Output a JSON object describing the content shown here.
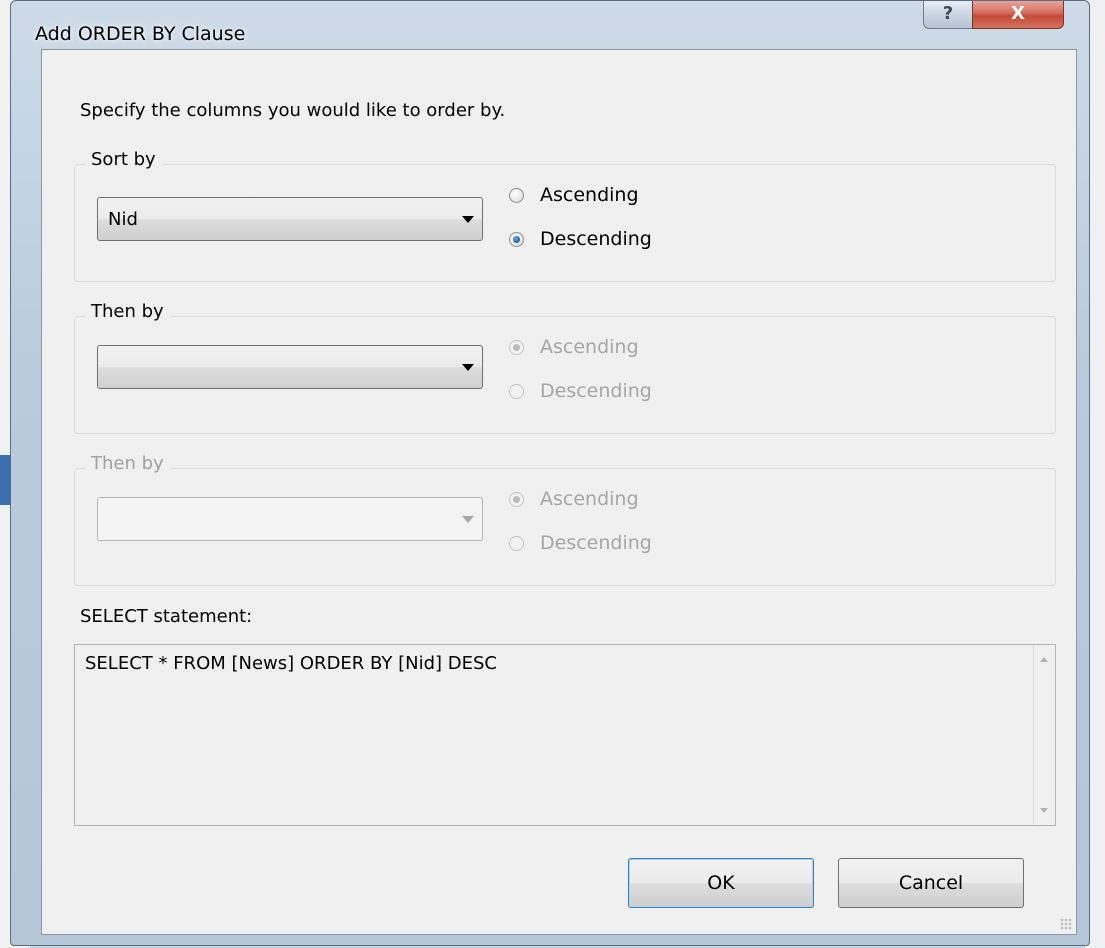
{
  "window": {
    "title": "Add ORDER BY Clause",
    "help_glyph": "?",
    "close_glyph": "X"
  },
  "instruction": "Specify the columns you would like to order by.",
  "groups": [
    {
      "title": "Sort by",
      "column": "Nid",
      "enabled": true,
      "options": [
        {
          "label": "Ascending",
          "checked": false
        },
        {
          "label": "Descending",
          "checked": true
        }
      ]
    },
    {
      "title": "Then by",
      "column": "",
      "enabled": true,
      "options": [
        {
          "label": "Ascending",
          "checked": true
        },
        {
          "label": "Descending",
          "checked": false
        }
      ]
    },
    {
      "title": "Then by",
      "column": "",
      "enabled": false,
      "options": [
        {
          "label": "Ascending",
          "checked": true
        },
        {
          "label": "Descending",
          "checked": false
        }
      ]
    }
  ],
  "statement": {
    "label": "SELECT statement:",
    "text": "SELECT * FROM [News] ORDER BY [Nid] DESC"
  },
  "buttons": {
    "ok": "OK",
    "cancel": "Cancel"
  }
}
